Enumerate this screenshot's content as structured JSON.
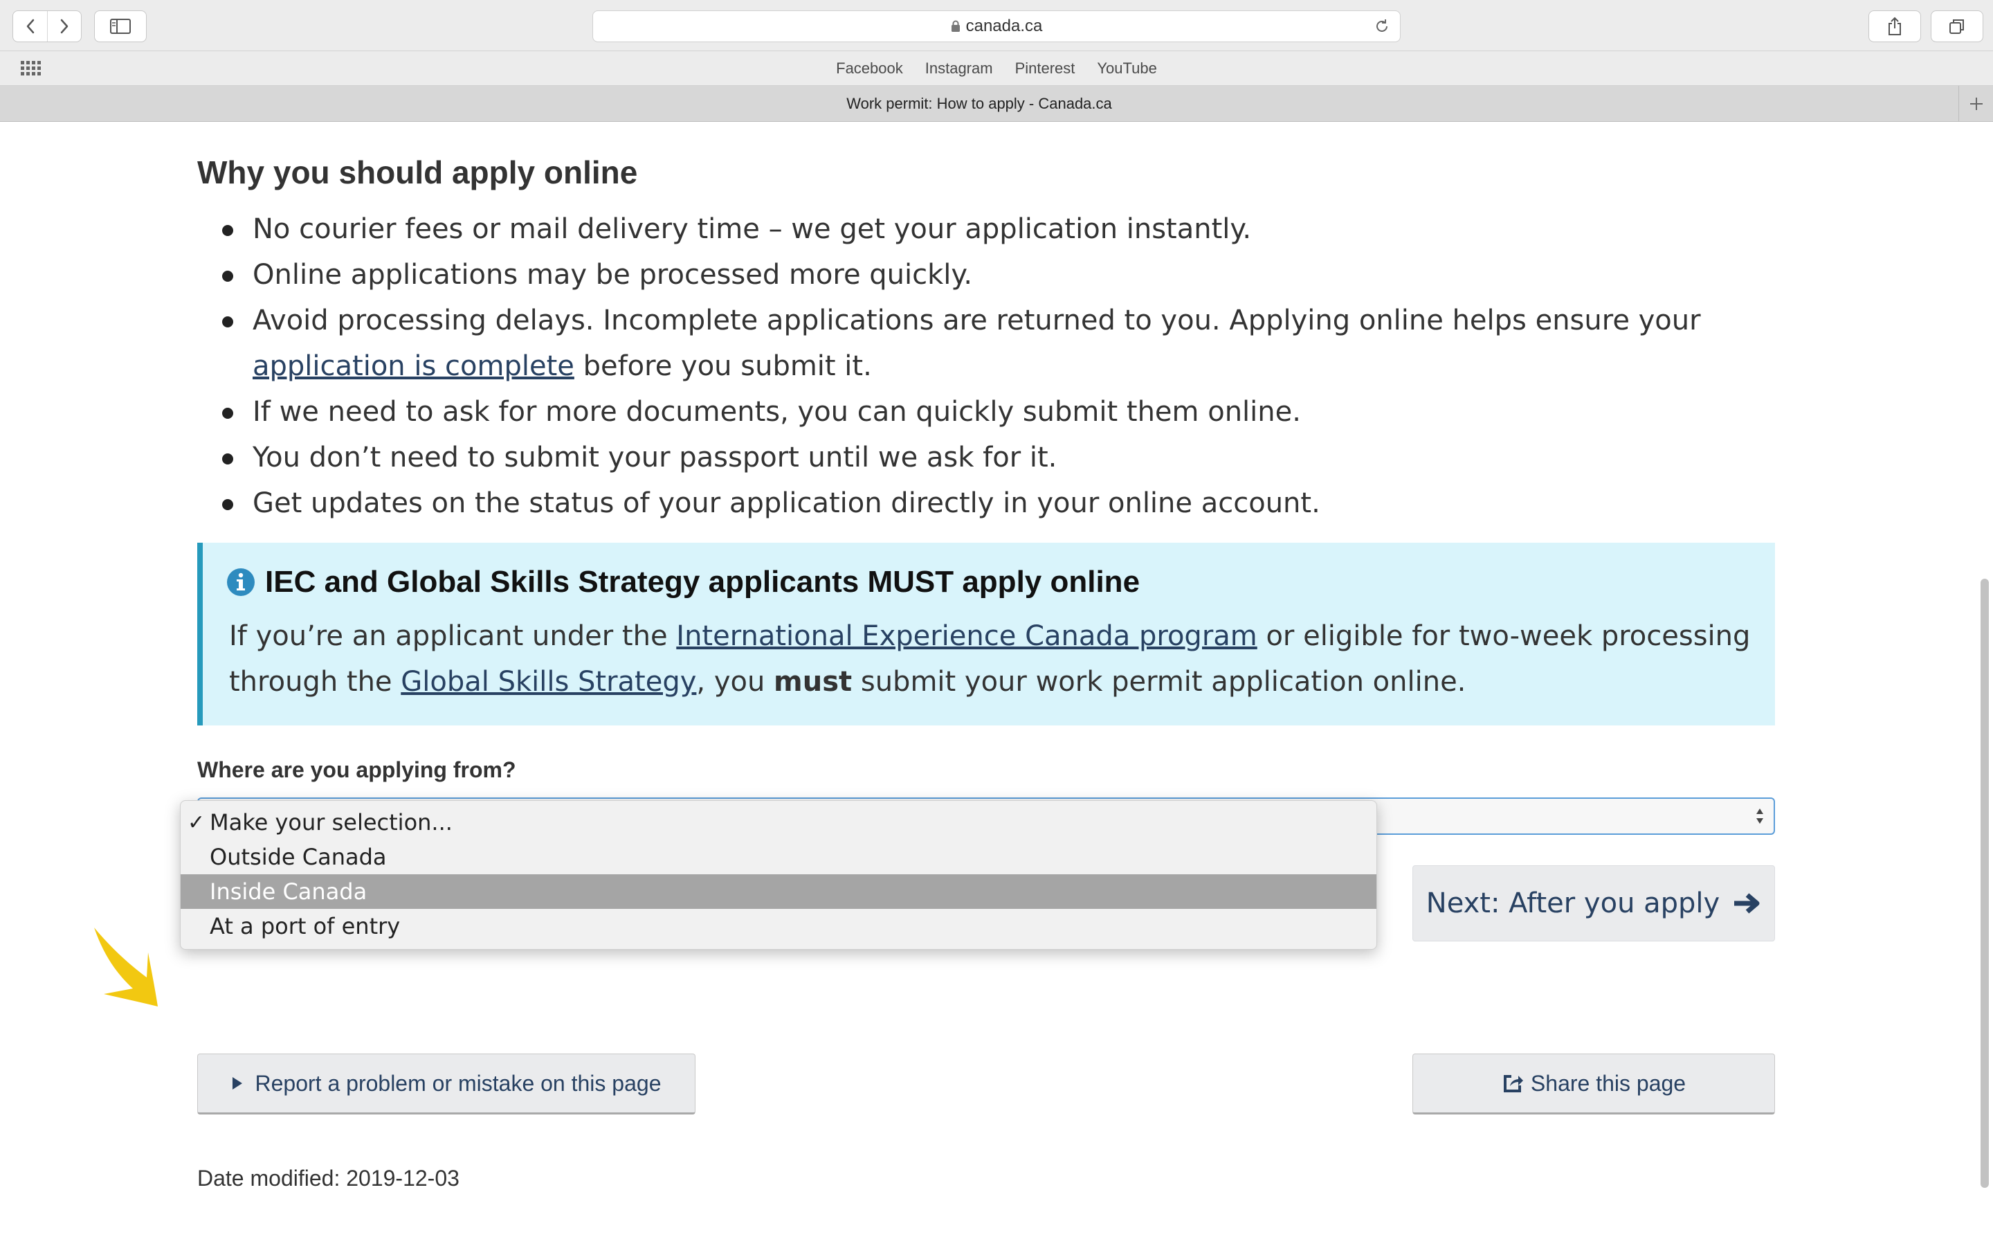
{
  "browser": {
    "address": "canada.ca",
    "favorites": [
      "Facebook",
      "Instagram",
      "Pinterest",
      "YouTube"
    ],
    "tab_title": "Work permit: How to apply - Canada.ca"
  },
  "content": {
    "heading": "Why you should apply online",
    "bullets": [
      {
        "text": "No courier fees or mail delivery time – we get your application instantly."
      },
      {
        "text": "Online applications may be processed more quickly."
      },
      {
        "text_before": "Avoid processing delays. Incomplete applications are returned to you. Applying online helps ensure your ",
        "link": "application is complete",
        "text_after": " before you submit it."
      },
      {
        "text": "If we need to ask for more documents, you can quickly submit them online."
      },
      {
        "text": "You don’t need to submit your passport until we ask for it."
      },
      {
        "text": "Get updates on the status of your application directly in your online account."
      }
    ],
    "alert": {
      "title": "IEC and Global Skills Strategy applicants MUST apply online",
      "part1": "If you’re an applicant under the ",
      "link1": "International Experience Canada program",
      "part2": " or eligible for two-week processing through the ",
      "link2": "Global Skills Strategy",
      "part3": ", you ",
      "bold": "must",
      "part4": " submit your work permit application online."
    },
    "question": "Where are you applying from?",
    "options": [
      "Make your selection...",
      "Outside Canada",
      "Inside Canada",
      "At a port of entry"
    ],
    "checked_option": "Make your selection...",
    "highlighted_option": "Inside Canada",
    "next_button": "Next: After you apply",
    "report_button": "Report a problem or mistake on this page",
    "share_button": "Share this page",
    "date_modified": "Date modified: 2019-12-03"
  },
  "colors": {
    "link": "#284162",
    "alert_bg": "#d9f4fb",
    "alert_border": "#269abc",
    "pointer": "#f2c811"
  }
}
